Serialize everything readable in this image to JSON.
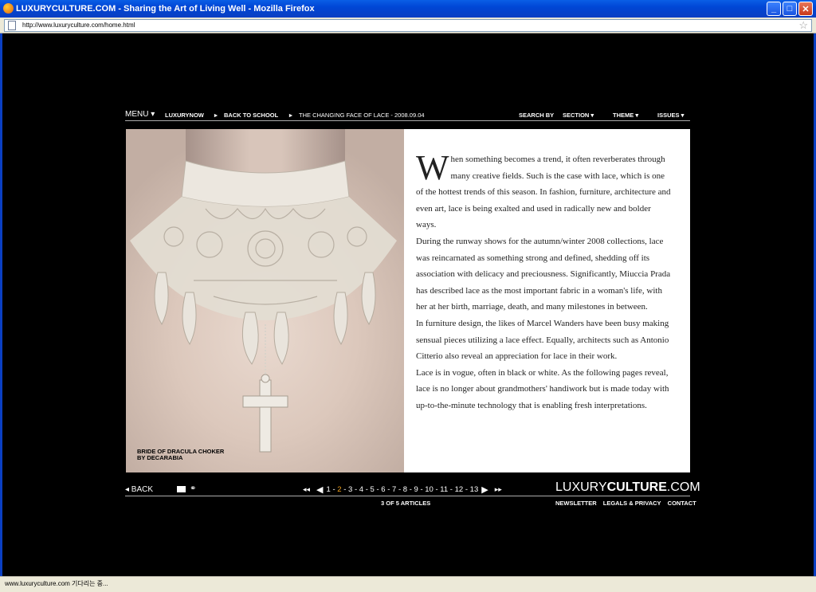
{
  "window": {
    "title": "LUXURYCULTURE.COM - Sharing the Art of Living Well - Mozilla Firefox",
    "url": "http://www.luxuryculture.com/home.html",
    "status": "www.luxuryculture.com 기다리는 중..."
  },
  "topnav": {
    "menu": "MENU ▾",
    "luxurynow": "LUXURYNOW",
    "back_to_school": "BACK TO SCHOOL",
    "article": "THE CHANGING FACE OF LACE - 2008.09.04",
    "search_by": "SEARCH BY",
    "section": "SECTION ▾",
    "theme": "THEME ▾",
    "issues": "ISSUES ▾"
  },
  "photo": {
    "caption_line1": "BRIDE OF DRACULA CHOKER",
    "caption_line2": "BY DECARABIA"
  },
  "article": {
    "dropcap": "W",
    "p1": "hen something becomes a trend, it often reverberates through many creative fields. Such is the case with lace, which is one of the hottest trends of this season. In fashion, furniture, architecture and even art, lace is being exalted and used in radically new and bolder ways.",
    "p2": "During the runway shows for the autumn/winter 2008 collections, lace was reincarnated as something strong and defined, shedding off its association with delicacy and preciousness. Significantly, Miuccia Prada has described lace as the most important fabric in a woman's life, with her at her birth, marriage, death, and many milestones in between.",
    "p3": "In furniture design, the likes of Marcel Wanders have been busy making sensual pieces utilizing a lace effect. Equally, architects such as Antonio Citterio also reveal an appreciation for lace in their work.",
    "p4": "Lace is in vogue, often in black or white. As the following pages reveal, lace is no longer about grandmothers' handiwork but is made today with up-to-the-minute technology that is enabling fresh interpretations."
  },
  "footer": {
    "back": "◂ BACK",
    "pages": [
      "1",
      "2",
      "3",
      "4",
      "5",
      "6",
      "7",
      "8",
      "9",
      "10",
      "11",
      "12",
      "13"
    ],
    "current_page": "2",
    "articles_count": "3 OF 5 ARTICLES",
    "logo_light": "LUXURY",
    "logo_bold": "CULTURE",
    "logo_suffix": ".COM",
    "newsletter": "NEWSLETTER",
    "legals": "LEGALS & PRIVACY",
    "contact": "CONTACT"
  },
  "colors": {
    "background": "#000000",
    "current_page": "#f3a21b",
    "titlebar": "#0046d5"
  }
}
